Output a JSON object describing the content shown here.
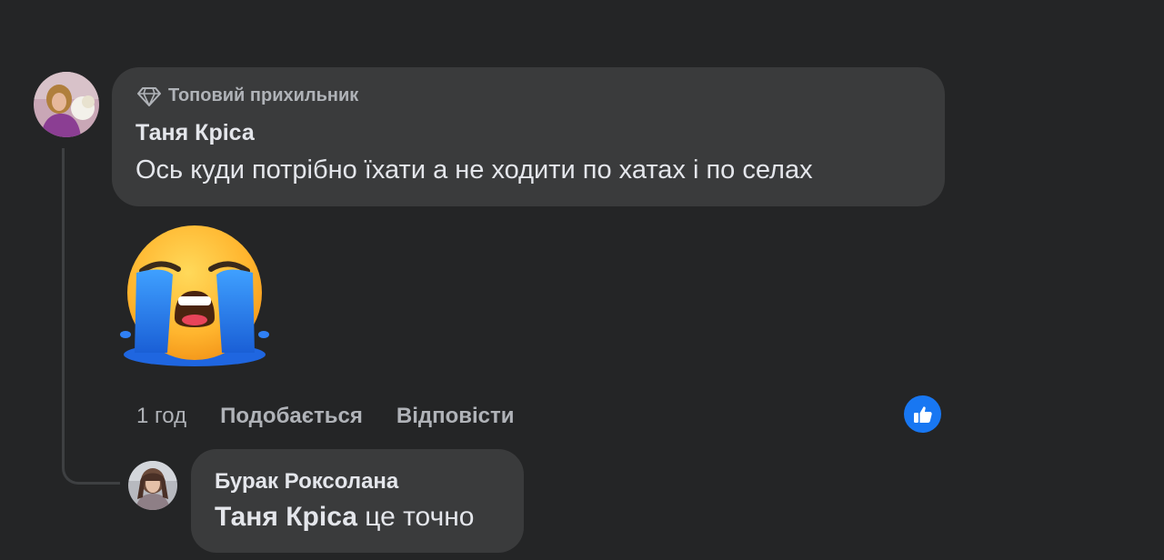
{
  "comment": {
    "badge_label": "Топовий прихильник",
    "badge_icon": "diamond-icon",
    "author": "Таня Кріса",
    "text": "Ось куди потрібно їхати а не ходити по хатах і по селах",
    "sticker": "loudly-crying-face-emoji",
    "time": "1 год",
    "like_label": "Подобається",
    "reply_label": "Відповісти",
    "reaction_icon": "thumbs-up-icon",
    "reaction_color": "#1877f2"
  },
  "reply": {
    "author": "Бурак Роксолана",
    "mention": "Таня Кріса",
    "text": "це точно"
  },
  "colors": {
    "background": "#242526",
    "bubble": "#3a3b3c",
    "primary_text": "#e4e6eb",
    "secondary_text": "#b0b3b8"
  }
}
